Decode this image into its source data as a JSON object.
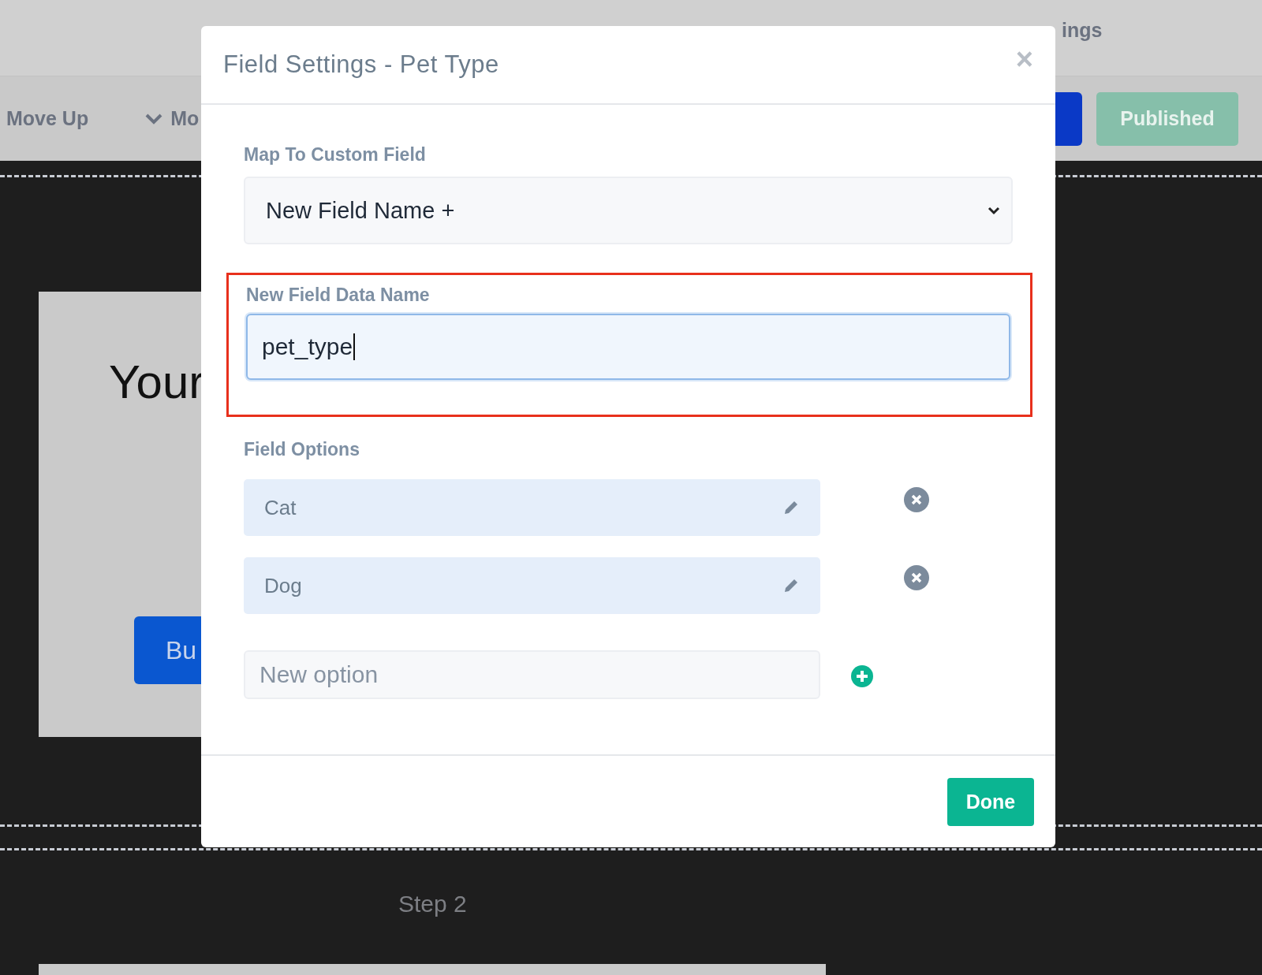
{
  "top_nav": {
    "items": [
      {
        "label": "ings"
      }
    ]
  },
  "toolbar": {
    "move_up": "Move Up",
    "move_down": "Mo",
    "published": "Published"
  },
  "canvas": {
    "heading": "Your",
    "button": "Bu",
    "step": "Step 2"
  },
  "modal": {
    "title": "Field Settings - Pet Type",
    "close": "×",
    "map_field": {
      "label": "Map To Custom Field",
      "value": "New Field Name +"
    },
    "data_name": {
      "label": "New Field Data Name",
      "value": "pet_type",
      "highlighted": true
    },
    "options_label": "Field Options",
    "options": [
      {
        "label": "Cat"
      },
      {
        "label": "Dog"
      }
    ],
    "new_option": {
      "placeholder": "New option"
    },
    "done": "Done"
  }
}
